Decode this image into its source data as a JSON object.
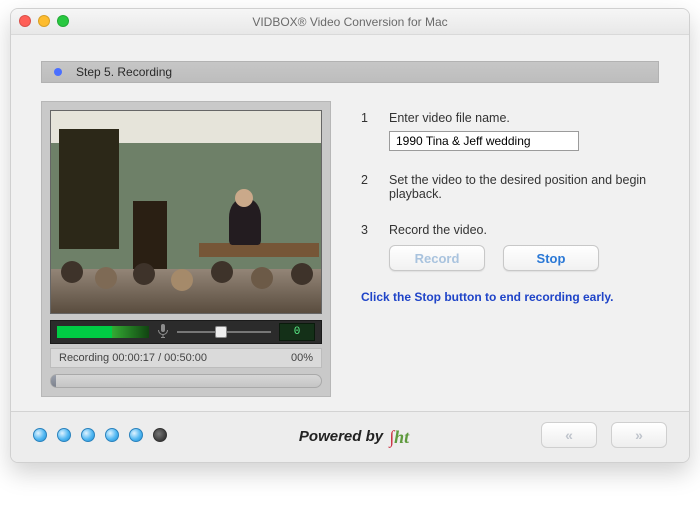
{
  "window": {
    "title": "VIDBOX® Video Conversion for Mac"
  },
  "step_bar": {
    "label": "Step 5. Recording"
  },
  "transport": {
    "counter": "0",
    "status_text": "Recording 00:00:17 / 00:50:00",
    "percent": "00%"
  },
  "steps": {
    "s1": {
      "num": "1",
      "label": "Enter video file name.",
      "filename": "1990 Tina & Jeff wedding"
    },
    "s2": {
      "num": "2",
      "label": "Set the video to the desired position and begin playback."
    },
    "s3": {
      "num": "3",
      "label": "Record the video."
    }
  },
  "buttons": {
    "record": "Record",
    "stop": "Stop"
  },
  "hint": "Click the Stop button to end recording early.",
  "footer": {
    "powered": "Powered by",
    "brand": "ht",
    "prev": "«",
    "next": "»"
  }
}
